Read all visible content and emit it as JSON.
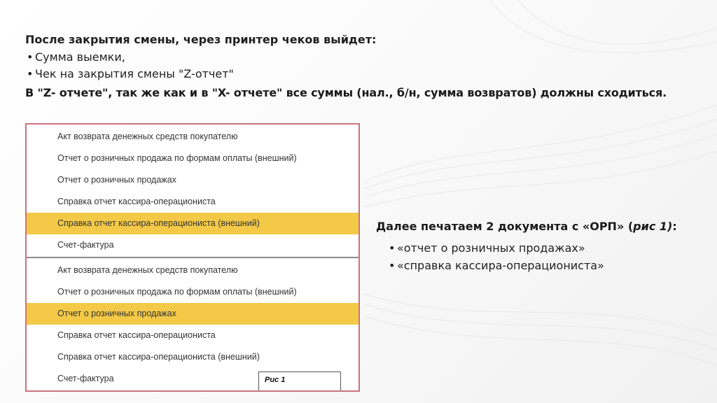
{
  "header": {
    "title": "После закрытия смены, через принтер чеков выйдет:",
    "bullets": [
      "Сумма выемки,",
      "Чек на закрытия смены \"Z-отчет\""
    ],
    "emphasis": "В \"Z- отчете\", так же как и в \"X- отчете\" все суммы (нал., б/н, сумма возвратов) должны сходиться."
  },
  "screenshot": {
    "group1": [
      {
        "label": "Акт возврата денежных средств покупателю",
        "selected": false
      },
      {
        "label": "Отчет о розничных продажа по формам оплаты (внешний)",
        "selected": false
      },
      {
        "label": "Отчет о розничных продажах",
        "selected": false
      },
      {
        "label": "Справка отчет кассира-операциониста",
        "selected": false
      },
      {
        "label": "Справка отчет кассира-операциониста (внешний)",
        "selected": true
      },
      {
        "label": "Счет-фактура",
        "selected": false
      }
    ],
    "group2": [
      {
        "label": "Акт возврата денежных средств покупателю",
        "selected": false
      },
      {
        "label": "Отчет о розничных продажа по формам оплаты (внешний)",
        "selected": false
      },
      {
        "label": "Отчет о розничных продажах",
        "selected": true
      },
      {
        "label": "Справка отчет кассира-операциониста",
        "selected": false
      },
      {
        "label": "Справка отчет кассира-операциониста (внешний)",
        "selected": false
      },
      {
        "label": "Счет-фактура",
        "selected": false
      }
    ],
    "figure_label": "Рис 1",
    "highlight_color": "#f3c947",
    "border_color": "#c8737e"
  },
  "right": {
    "title_prefix": "Далее печатаем 2 документа с «ОРП» (",
    "title_italic": "рис 1)",
    "title_suffix": ":",
    "items": [
      "«отчет о розничных продажах»",
      "«справка кассира-операциониста»"
    ]
  },
  "bullet_glyph": "•"
}
